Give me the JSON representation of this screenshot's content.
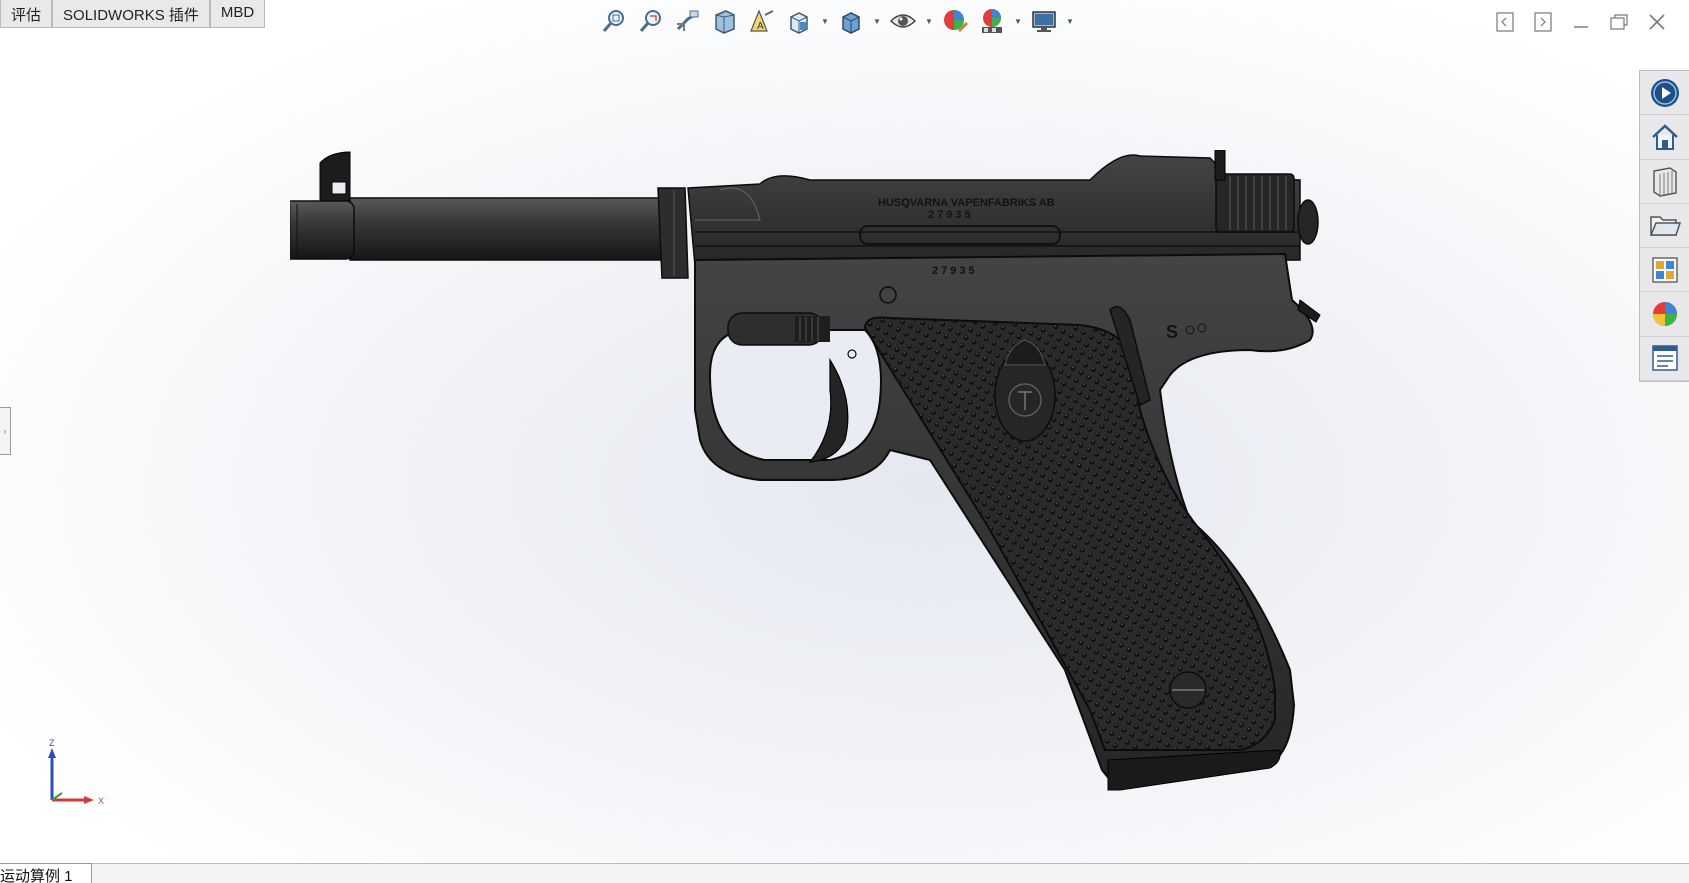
{
  "tabs": [
    "评估",
    "SOLIDWORKS 插件",
    "MBD"
  ],
  "view_toolbar": {
    "icons": [
      "zoom-to-fit-icon",
      "zoom-to-area-icon",
      "previous-view-icon",
      "section-view-icon",
      "dynamic-annotation-views-icon",
      "view-orientation-icon",
      "display-style-icon",
      "hide-show-items-icon",
      "edit-appearance-icon",
      "apply-scene-icon",
      "view-settings-icon"
    ]
  },
  "window_controls": [
    "restore-left-icon",
    "restore-right-icon",
    "minimize-icon",
    "maximize-icon",
    "close-icon"
  ],
  "task_pane": {
    "items": [
      "solidworks-resources-icon",
      "home-icon",
      "design-library-icon",
      "file-explorer-icon",
      "view-palette-icon",
      "appearances-scenes-icon",
      "custom-properties-icon"
    ]
  },
  "model": {
    "engraving_name": "HUSQVARNA VAPENFABRIKS AB",
    "serial_top": "27935",
    "serial_frame": "27935",
    "safety_mark": "S"
  },
  "triad": {
    "z_label": "Z",
    "x_label": "X"
  },
  "bottom_tab": {
    "label": "运动算例 1"
  },
  "colors": {
    "model_dark": "#2b2b2b",
    "grip": "#1f1f1f",
    "background": "#e8ebf2"
  }
}
